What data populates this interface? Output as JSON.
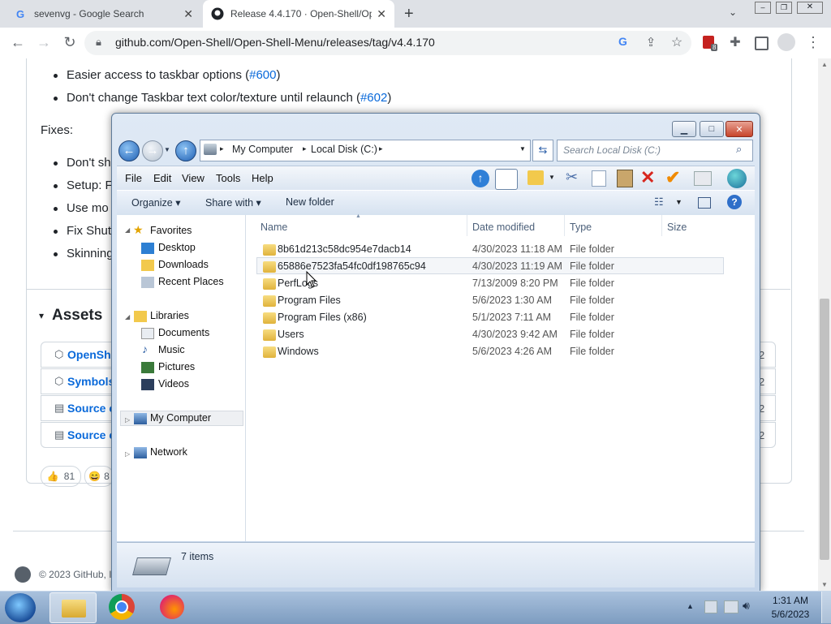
{
  "browser": {
    "tabs": [
      {
        "title": "sevenvg - Google Search",
        "active": false
      },
      {
        "title": "Release 4.4.170 · Open-Shell/Op",
        "active": true
      }
    ],
    "url": "github.com/Open-Shell/Open-Shell-Menu/releases/tag/v4.4.170",
    "extension_badge": "8"
  },
  "github": {
    "bullets_top": [
      {
        "text": "Easier access to taskbar options (",
        "link": "#600",
        "tail": ")"
      },
      {
        "text": "Don't change Taskbar text color/texture until relaunch (",
        "link": "#602",
        "tail": ")"
      }
    ],
    "fixes_label": "Fixes:",
    "fix_bullets": [
      "Don't sh",
      "Setup: F",
      "Use mo",
      "Fix Shut",
      "Skinning"
    ],
    "assets_title": "Assets",
    "assets": [
      {
        "name": "OpenShe",
        "suffix": "2"
      },
      {
        "name": "Symbols",
        "suffix": "2"
      },
      {
        "name": "Source c",
        "suffix": "2"
      },
      {
        "name": "Source c",
        "suffix": "2"
      }
    ],
    "reactions": [
      {
        "emoji": "👍",
        "count": "81"
      },
      {
        "emoji": "😄",
        "count": "8"
      }
    ],
    "footer": "© 2023 GitHub, I"
  },
  "explorer": {
    "breadcrumb": [
      "My Computer",
      "Local Disk (C:)"
    ],
    "search_placeholder": "Search Local Disk (C:)",
    "menu": [
      "File",
      "Edit",
      "View",
      "Tools",
      "Help"
    ],
    "commands": {
      "organize": "Organize",
      "share": "Share with",
      "newfolder": "New folder"
    },
    "nav": {
      "favorites": "Favorites",
      "fav_items": [
        "Desktop",
        "Downloads",
        "Recent Places"
      ],
      "libraries": "Libraries",
      "lib_items": [
        "Documents",
        "Music",
        "Pictures",
        "Videos"
      ],
      "computer": "My Computer",
      "network": "Network"
    },
    "columns": [
      "Name",
      "Date modified",
      "Type",
      "Size"
    ],
    "files": [
      {
        "name": "8b61d213c58dc954e7dacb14",
        "date": "4/30/2023 11:18 AM",
        "type": "File folder"
      },
      {
        "name": "65886e7523fa54fc0df198765c94",
        "date": "4/30/2023 11:19 AM",
        "type": "File folder"
      },
      {
        "name": "PerfLogs",
        "date": "7/13/2009 8:20 PM",
        "type": "File folder"
      },
      {
        "name": "Program Files",
        "date": "5/6/2023 1:30 AM",
        "type": "File folder"
      },
      {
        "name": "Program Files (x86)",
        "date": "5/1/2023 7:11 AM",
        "type": "File folder"
      },
      {
        "name": "Users",
        "date": "4/30/2023 9:42 AM",
        "type": "File folder"
      },
      {
        "name": "Windows",
        "date": "5/6/2023 4:26 AM",
        "type": "File folder"
      }
    ],
    "status": "7 items"
  },
  "taskbar": {
    "time": "1:31 AM",
    "date": "5/6/2023"
  }
}
